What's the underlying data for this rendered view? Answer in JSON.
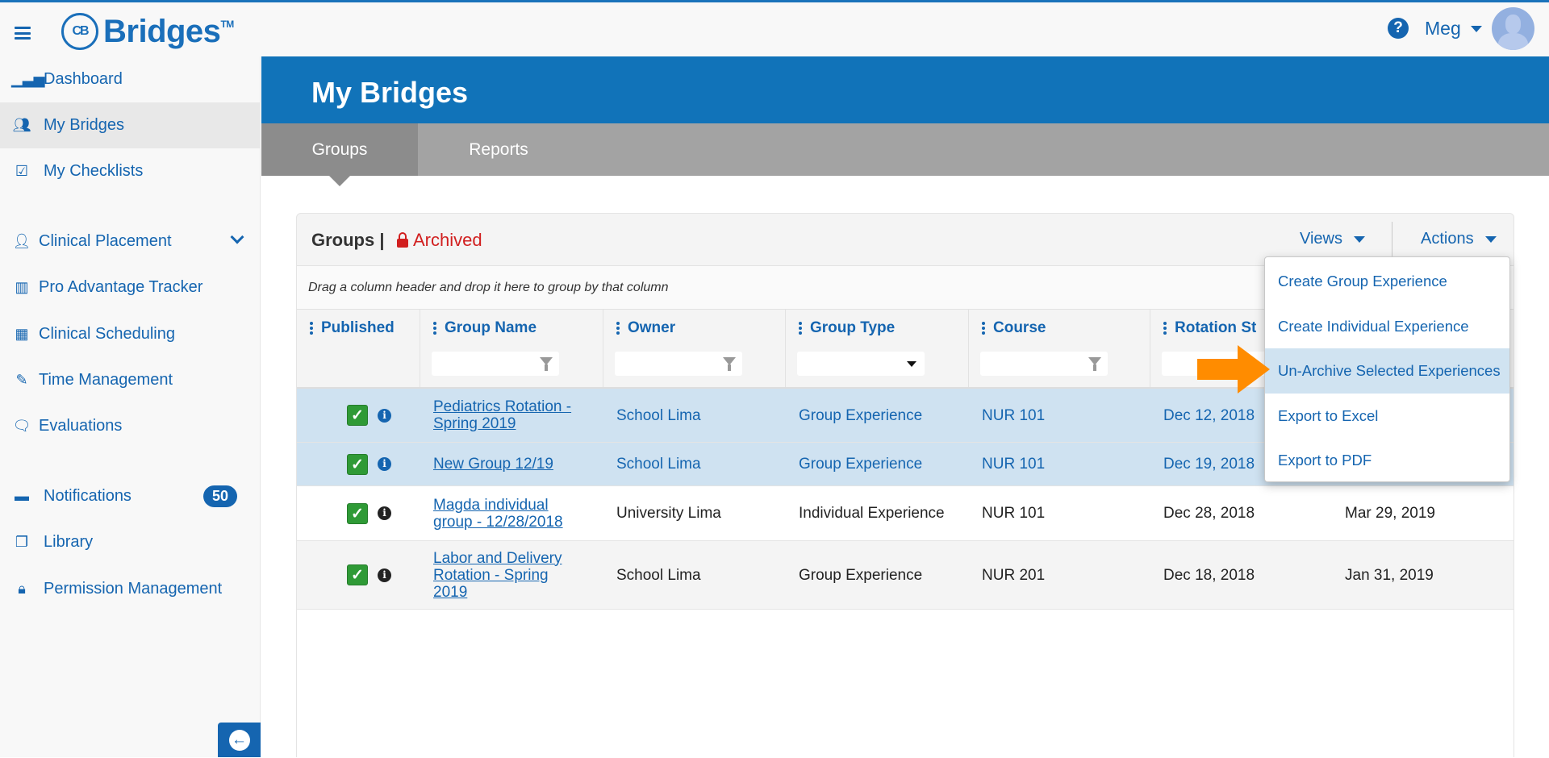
{
  "header": {
    "brand": "Bridges",
    "brand_mark": "CB",
    "trademark": "TM",
    "user": "Meg",
    "icons": {
      "menu": "hamburger-icon",
      "help": "question-circle-icon",
      "avatar": "user-silhouette-icon"
    }
  },
  "sidebar": {
    "items": [
      {
        "label": "Dashboard",
        "icon": "bar-chart-icon"
      },
      {
        "label": "My Bridges",
        "icon": "users-icon",
        "active": true
      },
      {
        "label": "My Checklists",
        "icon": "check-square-icon"
      },
      {
        "label": "Clinical Placement",
        "icon": "doctor-icon",
        "expandable": true
      },
      {
        "label": "Pro Advantage Tracker",
        "icon": "map-icon"
      },
      {
        "label": "Clinical Scheduling",
        "icon": "calendar-icon"
      },
      {
        "label": "Time Management",
        "icon": "edit-icon"
      },
      {
        "label": "Evaluations",
        "icon": "comments-icon"
      },
      {
        "label": "Notifications",
        "icon": "inbox-icon",
        "badge": "50"
      },
      {
        "label": "Library",
        "icon": "copy-icon"
      },
      {
        "label": "Permission Management",
        "icon": "lock-icon"
      }
    ]
  },
  "page": {
    "title": "My Bridges",
    "tabs": [
      {
        "label": "Groups",
        "active": true
      },
      {
        "label": "Reports"
      }
    ]
  },
  "panel": {
    "title": "Groups |",
    "status": "Archived",
    "views_label": "Views",
    "actions_label": "Actions",
    "group_hint": "Drag a column header and drop it here to group by that column",
    "columns": [
      "Published",
      "Group Name",
      "Owner",
      "Group Type",
      "Course",
      "Rotation St",
      ""
    ],
    "rows": [
      {
        "published": true,
        "name": "Pediatrics Rotation - Spring 2019",
        "owner": "School Lima",
        "type": "Group Experience",
        "course": "NUR 101",
        "start": "Dec 12, 2018",
        "end": "",
        "selected": true
      },
      {
        "published": true,
        "name": "New Group 12/19",
        "owner": "School Lima",
        "type": "Group Experience",
        "course": "NUR 101",
        "start": "Dec 19, 2018",
        "end": "",
        "selected": true
      },
      {
        "published": true,
        "name": "Magda individual group - 12/28/2018",
        "owner": "University Lima",
        "type": "Individual Experience",
        "course": "NUR 101",
        "start": "Dec 28, 2018",
        "end": "Mar 29, 2019",
        "selected": false
      },
      {
        "published": true,
        "name": "Labor and Delivery Rotation - Spring 2019",
        "owner": "School Lima",
        "type": "Group Experience",
        "course": "NUR 201",
        "start": "Dec 18, 2018",
        "end": "Jan 31, 2019",
        "selected": false
      }
    ]
  },
  "actions_menu": {
    "items": [
      "Create Group Experience",
      "Create Individual Experience",
      "Un-Archive Selected Experiences",
      "Export to Excel",
      "Export to PDF"
    ],
    "highlighted": 2
  },
  "colors": {
    "primary": "#1173b9",
    "archived": "#d11f1f",
    "published": "#2f9a36",
    "selected_row": "#cfe2f1",
    "annotation_arrow": "#ff8c00"
  }
}
